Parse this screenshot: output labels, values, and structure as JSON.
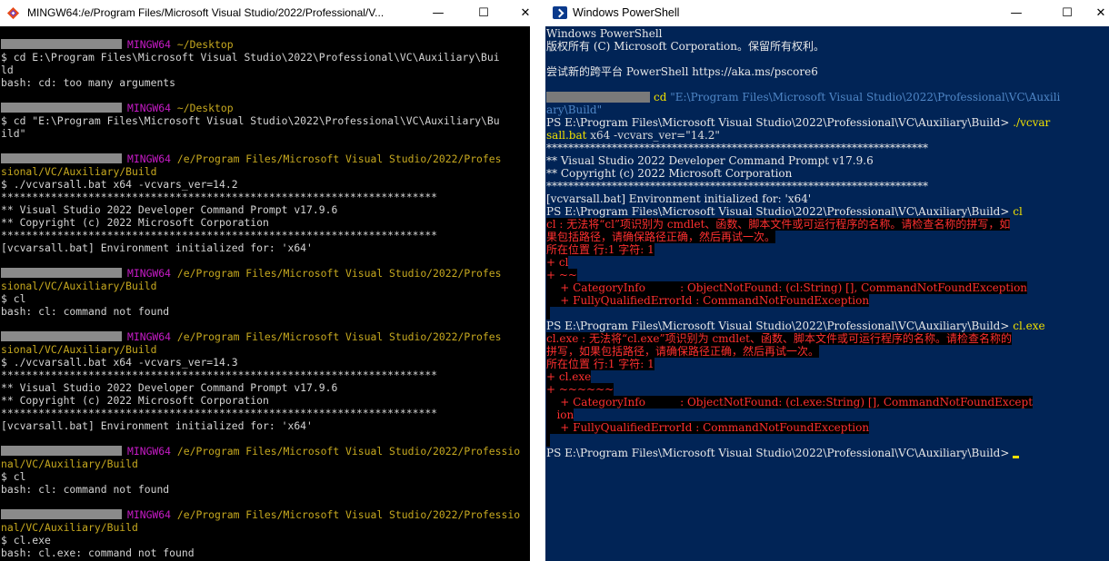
{
  "mingw": {
    "title": "MINGW64:/e/Program Files/Microsoft Visual Studio/2022/Professional/V...",
    "controls": {
      "minimize": "—",
      "maximize": "☐",
      "close": "✕"
    },
    "lines": [
      {
        "type": "prompt",
        "host": "MINGW64",
        "path": "~/Desktop"
      },
      {
        "type": "out",
        "text": "$ cd E:\\Program Files\\Microsoft Visual Studio\\2022\\Professional\\VC\\Auxiliary\\Bui"
      },
      {
        "type": "out",
        "text": "ld"
      },
      {
        "type": "out",
        "text": "bash: cd: too many arguments"
      },
      {
        "type": "blank"
      },
      {
        "type": "prompt",
        "host": "MINGW64",
        "path": "~/Desktop"
      },
      {
        "type": "out",
        "text": "$ cd \"E:\\Program Files\\Microsoft Visual Studio\\2022\\Professional\\VC\\Auxiliary\\Bu"
      },
      {
        "type": "out",
        "text": "ild\""
      },
      {
        "type": "blank"
      },
      {
        "type": "prompt",
        "host": "MINGW64",
        "path": "/e/Program Files/Microsoft Visual Studio/2022/Profes"
      },
      {
        "type": "path",
        "text": "sional/VC/Auxiliary/Build"
      },
      {
        "type": "out",
        "text": "$ ./vcvarsall.bat x64 -vcvars_ver=14.2"
      },
      {
        "type": "out",
        "text": "**********************************************************************"
      },
      {
        "type": "out",
        "text": "** Visual Studio 2022 Developer Command Prompt v17.9.6"
      },
      {
        "type": "out",
        "text": "** Copyright (c) 2022 Microsoft Corporation"
      },
      {
        "type": "out",
        "text": "**********************************************************************"
      },
      {
        "type": "out",
        "text": "[vcvarsall.bat] Environment initialized for: 'x64'"
      },
      {
        "type": "blank"
      },
      {
        "type": "prompt",
        "host": "MINGW64",
        "path": "/e/Program Files/Microsoft Visual Studio/2022/Profes"
      },
      {
        "type": "path",
        "text": "sional/VC/Auxiliary/Build"
      },
      {
        "type": "out",
        "text": "$ cl"
      },
      {
        "type": "out",
        "text": "bash: cl: command not found"
      },
      {
        "type": "blank"
      },
      {
        "type": "prompt",
        "host": "MINGW64",
        "path": "/e/Program Files/Microsoft Visual Studio/2022/Profes"
      },
      {
        "type": "path",
        "text": "sional/VC/Auxiliary/Build"
      },
      {
        "type": "out",
        "text": "$ ./vcvarsall.bat x64 -vcvars_ver=14.3"
      },
      {
        "type": "out",
        "text": "**********************************************************************"
      },
      {
        "type": "out",
        "text": "** Visual Studio 2022 Developer Command Prompt v17.9.6"
      },
      {
        "type": "out",
        "text": "** Copyright (c) 2022 Microsoft Corporation"
      },
      {
        "type": "out",
        "text": "**********************************************************************"
      },
      {
        "type": "out",
        "text": "[vcvarsall.bat] Environment initialized for: 'x64'"
      },
      {
        "type": "blank"
      },
      {
        "type": "prompt",
        "host": "MINGW64",
        "path": "/e/Program Files/Microsoft Visual Studio/2022/Professio"
      },
      {
        "type": "path",
        "text": "nal/VC/Auxiliary/Build"
      },
      {
        "type": "out",
        "text": "$ cl"
      },
      {
        "type": "out",
        "text": "bash: cl: command not found"
      },
      {
        "type": "blank"
      },
      {
        "type": "prompt",
        "host": "MINGW64",
        "path": "/e/Program Files/Microsoft Visual Studio/2022/Professio"
      },
      {
        "type": "path",
        "text": "nal/VC/Auxiliary/Build"
      },
      {
        "type": "out",
        "text": "$ cl.exe"
      },
      {
        "type": "out",
        "text": "bash: cl.exe: command not found"
      }
    ]
  },
  "powershell": {
    "title": "Windows PowerShell",
    "controls": {
      "minimize": "—",
      "maximize": "☐",
      "close": "✕"
    },
    "lines": [
      {
        "segs": [
          {
            "t": "Windows PowerShell",
            "c": ""
          }
        ]
      },
      {
        "segs": [
          {
            "t": "版权所有 (C) Microsoft Corporation。保留所有权利。",
            "c": ""
          }
        ]
      },
      {
        "blank": true
      },
      {
        "segs": [
          {
            "t": "尝试新的跨平台 PowerShell https://aka.ms/pscore6",
            "c": ""
          }
        ]
      },
      {
        "blank": true
      },
      {
        "redact": true,
        "segs": [
          {
            "t": "cd ",
            "c": "p-cmd"
          },
          {
            "t": "\"E:\\Program Files\\Microsoft Visual Studio\\2022\\Professional\\VC\\Auxili",
            "c": "p-str"
          }
        ]
      },
      {
        "segs": [
          {
            "t": "ary\\Build\"",
            "c": "p-str"
          }
        ]
      },
      {
        "segs": [
          {
            "t": "PS E:\\Program Files\\Microsoft Visual Studio\\2022\\Professional\\VC\\Auxiliary\\Build> ",
            "c": ""
          },
          {
            "t": "./vcvar",
            "c": "p-cmd"
          }
        ]
      },
      {
        "segs": [
          {
            "t": "sall.bat",
            "c": "p-cmd"
          },
          {
            "t": " x64 -vcvars_ver=\"14.2\"",
            "c": "p-arg"
          }
        ]
      },
      {
        "segs": [
          {
            "t": "**********************************************************************",
            "c": ""
          }
        ]
      },
      {
        "segs": [
          {
            "t": "** Visual Studio 2022 Developer Command Prompt v17.9.6",
            "c": ""
          }
        ]
      },
      {
        "segs": [
          {
            "t": "** Copyright (c) 2022 Microsoft Corporation",
            "c": ""
          }
        ]
      },
      {
        "segs": [
          {
            "t": "**********************************************************************",
            "c": ""
          }
        ]
      },
      {
        "segs": [
          {
            "t": "[vcvarsall.bat] Environment initialized for: 'x64'",
            "c": ""
          }
        ]
      },
      {
        "segs": [
          {
            "t": "PS E:\\Program Files\\Microsoft Visual Studio\\2022\\Professional\\VC\\Auxiliary\\Build> ",
            "c": ""
          },
          {
            "t": "cl",
            "c": "p-cmd"
          }
        ]
      },
      {
        "segs": [
          {
            "t": "cl : 无法将“cl”项识别为 cmdlet、函数、脚本文件或可运行程序的名称。请检查名称的拼写，如",
            "c": "p-err"
          }
        ]
      },
      {
        "segs": [
          {
            "t": "果包括路径，请确保路径正确，然后再试一次。",
            "c": "p-err"
          }
        ]
      },
      {
        "segs": [
          {
            "t": "所在位置 行:1 字符: 1",
            "c": "p-err"
          }
        ]
      },
      {
        "segs": [
          {
            "t": "+ cl",
            "c": "p-err"
          }
        ]
      },
      {
        "segs": [
          {
            "t": "+ ~~",
            "c": "p-err"
          }
        ]
      },
      {
        "segs": [
          {
            "t": "    + CategoryInfo          : ObjectNotFound: (cl:String) [], CommandNotFoundException",
            "c": "p-err"
          }
        ]
      },
      {
        "segs": [
          {
            "t": "    + FullyQualifiedErrorId : CommandNotFoundException",
            "c": "p-err"
          }
        ]
      },
      {
        "segs": [
          {
            "t": " ",
            "c": "p-err"
          }
        ]
      },
      {
        "segs": [
          {
            "t": "PS E:\\Program Files\\Microsoft Visual Studio\\2022\\Professional\\VC\\Auxiliary\\Build> ",
            "c": ""
          },
          {
            "t": "cl.exe",
            "c": "p-cmd"
          }
        ]
      },
      {
        "segs": [
          {
            "t": "cl.exe : 无法将“cl.exe”项识别为 cmdlet、函数、脚本文件或可运行程序的名称。请检查名称的",
            "c": "p-err"
          }
        ]
      },
      {
        "segs": [
          {
            "t": "拼写，如果包括路径，请确保路径正确，然后再试一次。",
            "c": "p-err"
          }
        ]
      },
      {
        "segs": [
          {
            "t": "所在位置 行:1 字符: 1",
            "c": "p-err"
          }
        ]
      },
      {
        "segs": [
          {
            "t": "+ cl.exe",
            "c": "p-err"
          }
        ]
      },
      {
        "segs": [
          {
            "t": "+ ~~~~~~",
            "c": "p-err"
          }
        ]
      },
      {
        "segs": [
          {
            "t": "    + CategoryInfo          : ObjectNotFound: (cl.exe:String) [], CommandNotFoundExcept",
            "c": "p-err"
          }
        ]
      },
      {
        "segs": [
          {
            "t": "   ion",
            "c": "p-err"
          }
        ]
      },
      {
        "segs": [
          {
            "t": "    + FullyQualifiedErrorId : CommandNotFoundException",
            "c": "p-err"
          }
        ]
      },
      {
        "segs": [
          {
            "t": " ",
            "c": "p-err"
          }
        ]
      },
      {
        "segs": [
          {
            "t": "PS E:\\Program Files\\Microsoft Visual Studio\\2022\\Professional\\VC\\Auxiliary\\Build> ",
            "c": ""
          }
        ],
        "cursor": true
      }
    ]
  }
}
